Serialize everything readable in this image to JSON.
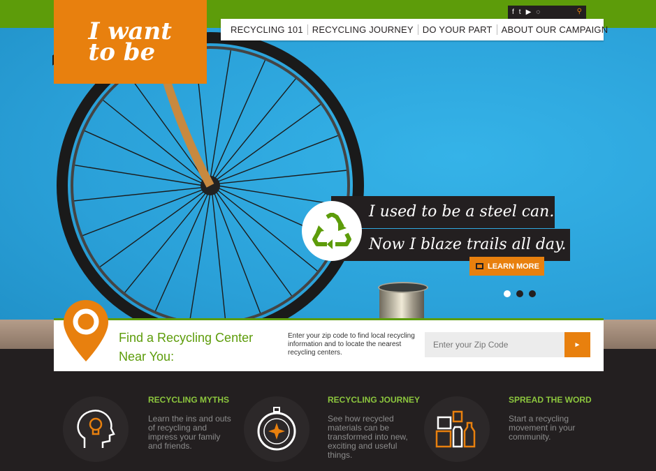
{
  "brand": {
    "logo_text": "I want to be",
    "accent": "#e8800e",
    "green": "#5d9c0a"
  },
  "social": [
    {
      "name": "facebook-icon",
      "glyph": "f"
    },
    {
      "name": "twitter-icon",
      "glyph": "t"
    },
    {
      "name": "youtube-icon",
      "glyph": "▶"
    },
    {
      "name": "blog-icon",
      "glyph": "💬"
    }
  ],
  "nav": [
    "RECYCLING 101",
    "RECYCLING JOURNEY",
    "DO YOUR PART",
    "ABOUT OUR CAMPAIGN"
  ],
  "hero": {
    "line1": "I used to be a steel can.",
    "line2": "Now I blaze trails all day.",
    "learn_more": "LEARN MORE",
    "active_slide": 1,
    "slide_count": 3
  },
  "finder": {
    "title": "Find a Recycling Center Near You:",
    "desc": "Enter your zip code to find local recycling information and to locate the nearest recycling centers.",
    "placeholder": "Enter your Zip Code",
    "submit_glyph": "►"
  },
  "features": [
    {
      "title": "RECYCLING MYTHS",
      "text": "Learn the ins and outs of recycling and impress your family and friends.",
      "icon": "head-lightbulb-icon"
    },
    {
      "title": "RECYCLING JOURNEY",
      "text": "See how recycled materials can be transformed into new, exciting and useful things.",
      "icon": "compass-icon"
    },
    {
      "title": "SPREAD THE WORD",
      "text": "Start a recycling movement in your community.",
      "icon": "recyclables-icon"
    }
  ]
}
